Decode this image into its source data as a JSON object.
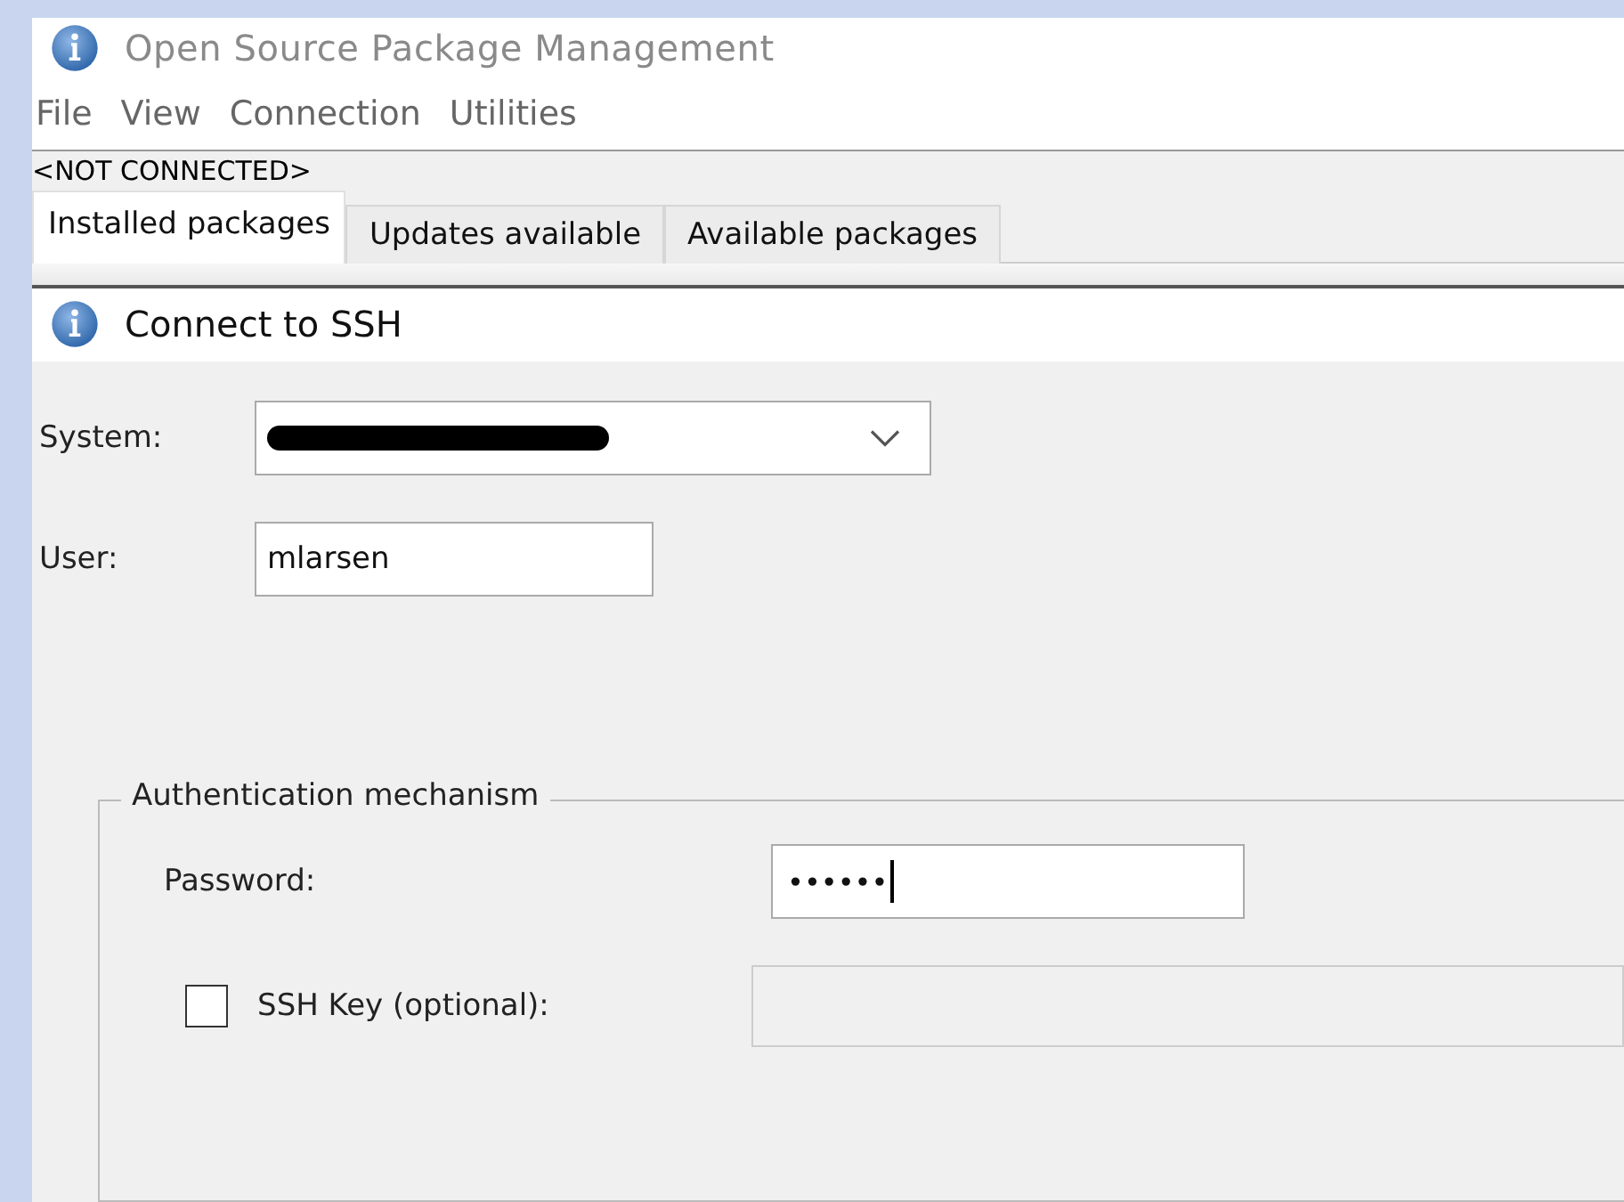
{
  "window": {
    "title": "Open Source Package Management"
  },
  "menu": [
    "File",
    "View",
    "Connection",
    "Utilities"
  ],
  "connection_status": "<NOT CONNECTED>",
  "tabs": [
    {
      "label": "Installed packages",
      "selected": true
    },
    {
      "label": "Updates available",
      "selected": false
    },
    {
      "label": "Available packages",
      "selected": false
    }
  ],
  "dialog": {
    "title": "Connect to SSH",
    "system": {
      "label": "System:",
      "redacted": true
    },
    "user": {
      "label": "User:",
      "value": "mlarsen"
    },
    "auth": {
      "title": "Authentication mechanism",
      "password": {
        "label": "Password:",
        "value": "••••••",
        "focused": true
      },
      "ssh_key": {
        "label": "SSH Key (optional):",
        "checked": false,
        "disabled": true
      }
    }
  }
}
